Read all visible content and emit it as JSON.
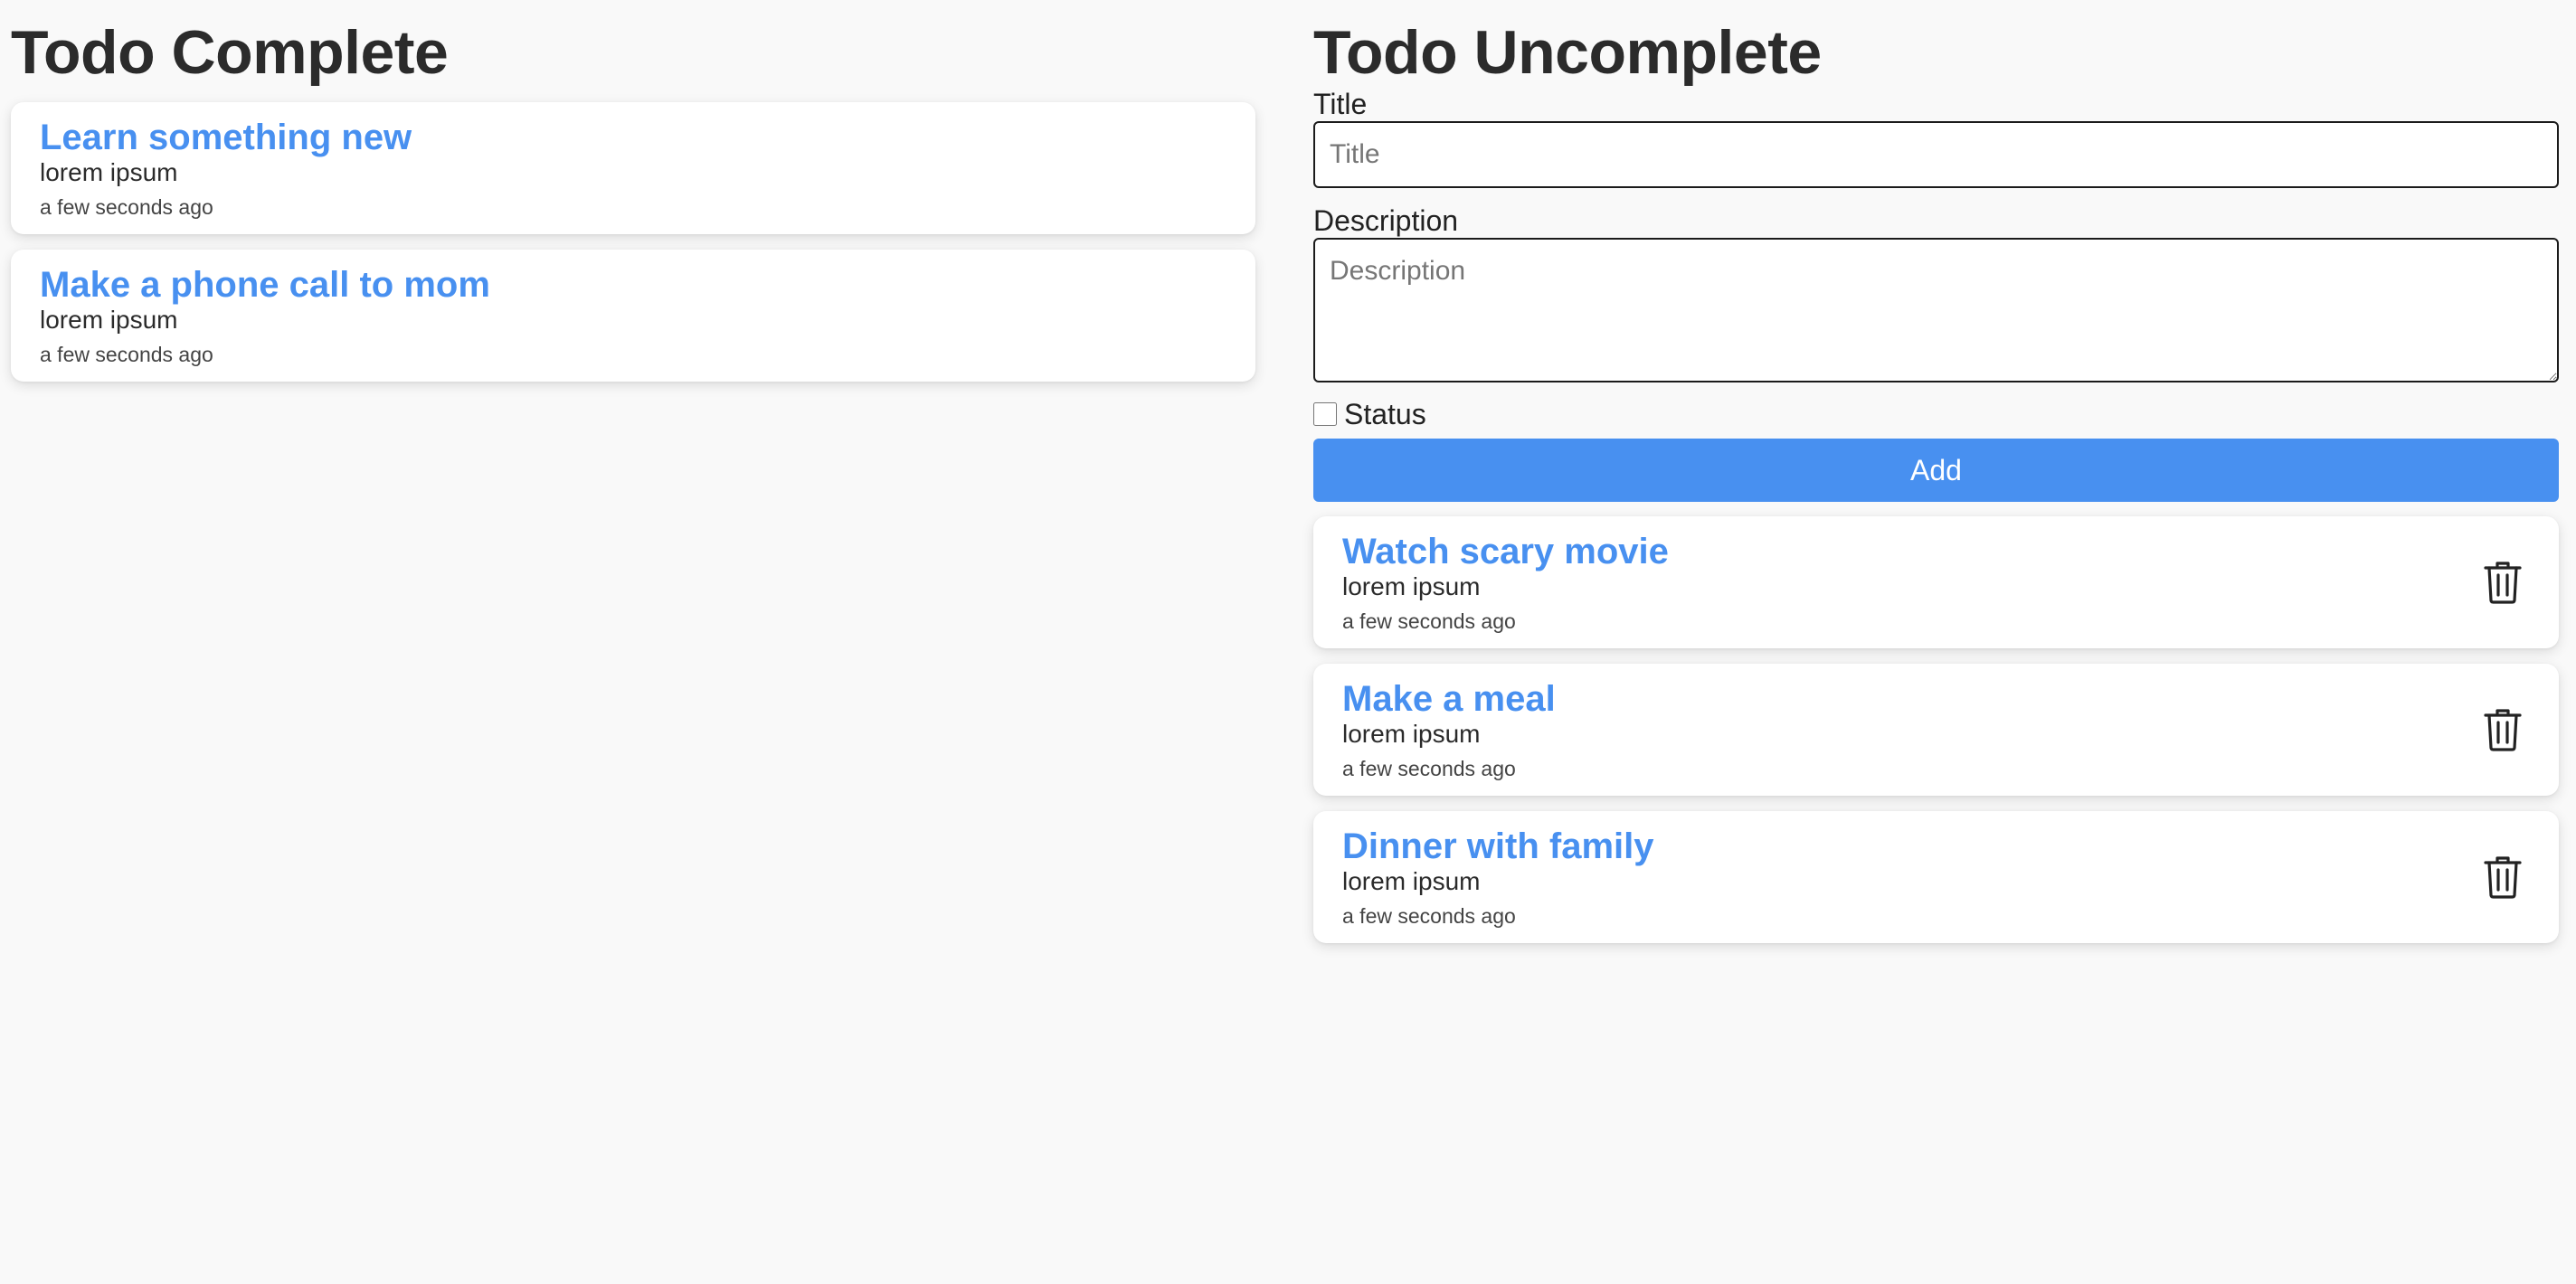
{
  "completed": {
    "heading": "Todo Complete",
    "todos": [
      {
        "title": "Learn something new",
        "description": "lorem ipsum",
        "time": "a few seconds ago"
      },
      {
        "title": "Make a phone call to mom",
        "description": "lorem ipsum",
        "time": "a few seconds ago"
      }
    ]
  },
  "uncompleted": {
    "heading": "Todo Uncomplete",
    "form": {
      "title_label": "Title",
      "title_placeholder": "Title",
      "title_value": "",
      "description_label": "Description",
      "description_placeholder": "Description",
      "description_value": "",
      "status_label": "Status",
      "status_checked": false,
      "add_label": "Add"
    },
    "todos": [
      {
        "title": "Watch scary movie",
        "description": "lorem ipsum",
        "time": "a few seconds ago",
        "action_icon": "trash-icon"
      },
      {
        "title": "Make a meal",
        "description": "lorem ipsum",
        "time": "a few seconds ago",
        "action_icon": "trash-icon"
      },
      {
        "title": "Dinner with family",
        "description": "lorem ipsum",
        "time": "a few seconds ago",
        "action_icon": "trash-icon"
      }
    ]
  },
  "colors": {
    "accent": "#4890f0",
    "heading": "#2b2b2b",
    "background": "#f9f9f9",
    "card": "#ffffff"
  }
}
